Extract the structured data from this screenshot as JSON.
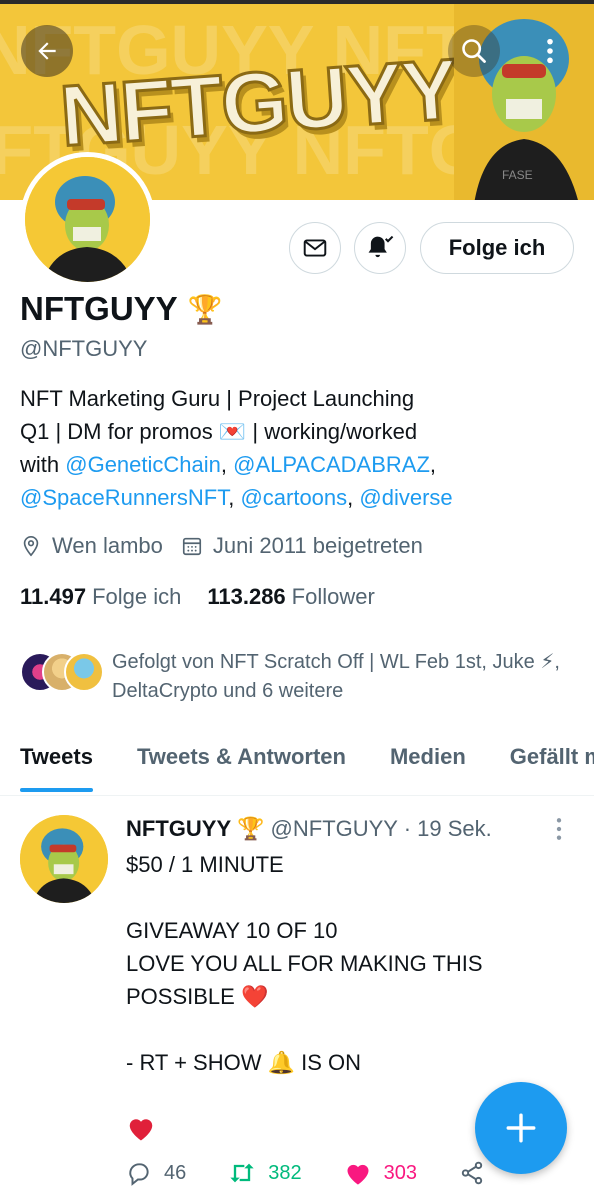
{
  "banner": {
    "text": "NFTGUYY"
  },
  "profile": {
    "display_name": "NFTGUYY",
    "name_emoji": "🏆",
    "handle": "@NFTGUYY",
    "bio_line1": "NFT Marketing Guru | Project Launching",
    "bio_line2_a": "Q1 | DM for promos",
    "bio_emoji": "💌",
    "bio_line2_b": " | working/worked",
    "bio_with": "with ",
    "mention1": "@GeneticChain",
    "sep1": ", ",
    "mention2": "@ALPACADABRAZ",
    "sep2": ",",
    "mention3": "@SpaceRunnersNFT",
    "sep3": ", ",
    "mention4": "@cartoons",
    "sep4": ", ",
    "mention5": "@diverse",
    "location": "Wen lambo",
    "joined": "Juni 2011 beigetreten",
    "following_count": "11.497",
    "following_label": "Folge ich",
    "followers_count": "113.286",
    "followers_label": "Follower",
    "followed_by": "Gefolgt von NFT Scratch Off | WL Feb 1st, Juke ⚡, DeltaCrypto und 6 weitere"
  },
  "actions": {
    "follow_label": "Folge ich"
  },
  "tabs": [
    {
      "label": "Tweets"
    },
    {
      "label": "Tweets & Antworten"
    },
    {
      "label": "Medien"
    },
    {
      "label": "Gefällt mir"
    }
  ],
  "tweet": {
    "name": "NFTGUYY",
    "name_emoji": "🏆",
    "handle_time": "@NFTGUYY · 19 Sek.",
    "body": "$50 / 1 MINUTE\n\nGIVEAWAY 10 OF 10\nLOVE YOU ALL FOR MAKING THIS POSSIBLE ❤️\n\n- RT + SHOW 🔔 IS ON",
    "replies": "46",
    "retweets": "382",
    "likes": "303"
  },
  "colors": {
    "accent": "#1d9bf0",
    "banner": "#f3c63a",
    "retweet": "#00ba7c",
    "like": "#f91880"
  },
  "icons": [
    "back-arrow-icon",
    "search-icon",
    "more-vertical-icon",
    "mail-icon",
    "bell-check-icon",
    "location-icon",
    "calendar-icon",
    "reply-icon",
    "retweet-icon",
    "heart-icon",
    "share-icon",
    "plus-icon"
  ]
}
